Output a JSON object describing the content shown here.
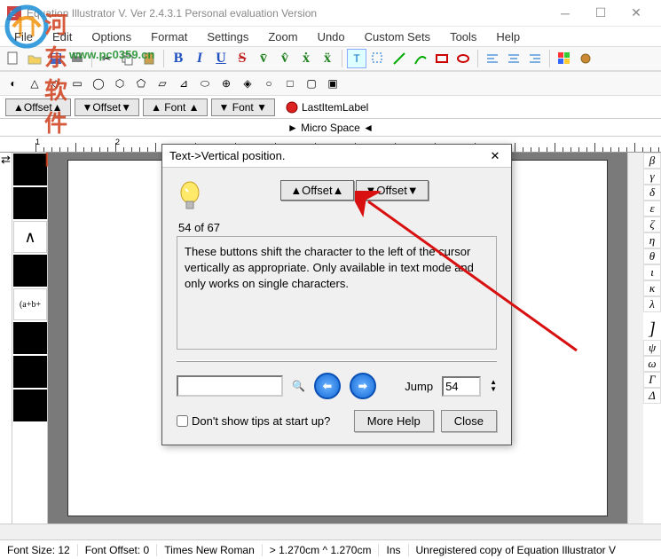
{
  "window": {
    "title": "Equation Illustrator V. Ver 2.4.3.1 Personal evaluation Version"
  },
  "menu": {
    "items": [
      "File",
      "Edit",
      "Options",
      "Format",
      "Settings",
      "Zoom",
      "Undo",
      "Custom Sets",
      "Tools",
      "Help"
    ]
  },
  "watermark": {
    "text": "河东软件园",
    "url": "www.pc0359.cn"
  },
  "offset_toolbar": {
    "offset_up": "▲Offset▲",
    "offset_down": "▼Offset▼",
    "font_up": "▲ Font ▲",
    "font_down": "▼ Font ▼",
    "last_item": "LastItemLabel"
  },
  "micro_space": "► Micro Space ◄",
  "palette": {
    "items": [
      "",
      "",
      "∧",
      "",
      "(a+b+",
      "",
      "",
      ""
    ]
  },
  "greek_panel": {
    "letters": [
      "β",
      "γ",
      "δ",
      "ε",
      "ζ",
      "η",
      "θ",
      "ι",
      "κ",
      "λ",
      "ψ",
      "ω",
      "Γ",
      "Δ",
      "",
      "",
      "",
      "",
      "",
      ""
    ]
  },
  "dialog": {
    "title": "Text->Vertical position.",
    "btn_up": "▲Offset▲",
    "btn_down": "▼Offset▼",
    "counter": "54 of 67",
    "description": "These buttons shift the character to the left of the cursor vertically as appropriate. Only available in text mode and only works on single characters.",
    "jump_label": "Jump",
    "jump_value": "54",
    "checkbox_label": "Don't show tips at start up?",
    "more_help": "More Help",
    "close": "Close"
  },
  "statusbar": {
    "font_size": "Font Size: 12",
    "font_offset": "Font Offset: 0",
    "font_name": "Times New Roman",
    "coords": "> 1.270cm  ^ 1.270cm",
    "mode": "Ins",
    "license": "Unregistered copy of Equation Illustrator V"
  }
}
